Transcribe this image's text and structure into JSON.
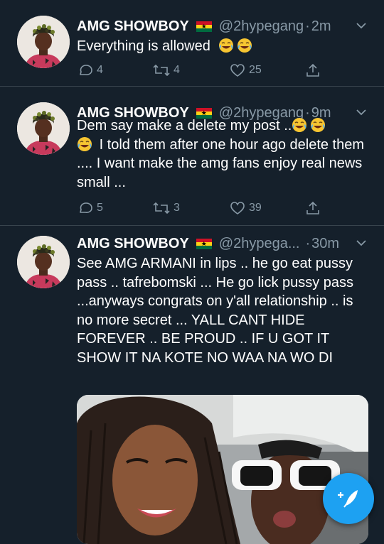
{
  "tweets": [
    {
      "name": "AMG SHOWBOY",
      "handle": "@2hypegang",
      "time": "2m",
      "text_lines": [
        "Everything is allowed"
      ],
      "replies": "4",
      "retweets": "4",
      "likes": "25"
    },
    {
      "name": "AMG SHOWBOY",
      "handle": "@2hypegang",
      "time": "9m",
      "text_line1": "Dem say make a delete my post ..",
      "text_rest": "I told them after one hour ago delete them .... I want make the amg  fans enjoy real news small ...",
      "replies": "5",
      "retweets": "3",
      "likes": "39"
    },
    {
      "name": "AMG SHOWBOY",
      "handle": "@2hypega...",
      "time": "30m",
      "text": "See AMG ARMANI in lips .. he go eat pussy pass .. tafrebomski ... He go lick pussy pass ...anyways congrats on y'all relationship .. is no more secret ... YALL CANT HIDE FOREVER .. BE PROUD .. IF U GOT IT SHOW IT NA KOTE NO  WAA NA WO DI"
    }
  ],
  "icons": {
    "reply": "reply-icon",
    "retweet": "retweet-icon",
    "like": "heart-icon",
    "share": "share-icon",
    "compose": "compose-tweet-icon",
    "flag": "ghana-flag-icon",
    "emoji": "face-with-tears-of-joy-emoji"
  },
  "colors": {
    "background": "#15202b",
    "secondary_text": "#8899a6",
    "accent": "#1da1f2",
    "divider": "#38444d"
  }
}
